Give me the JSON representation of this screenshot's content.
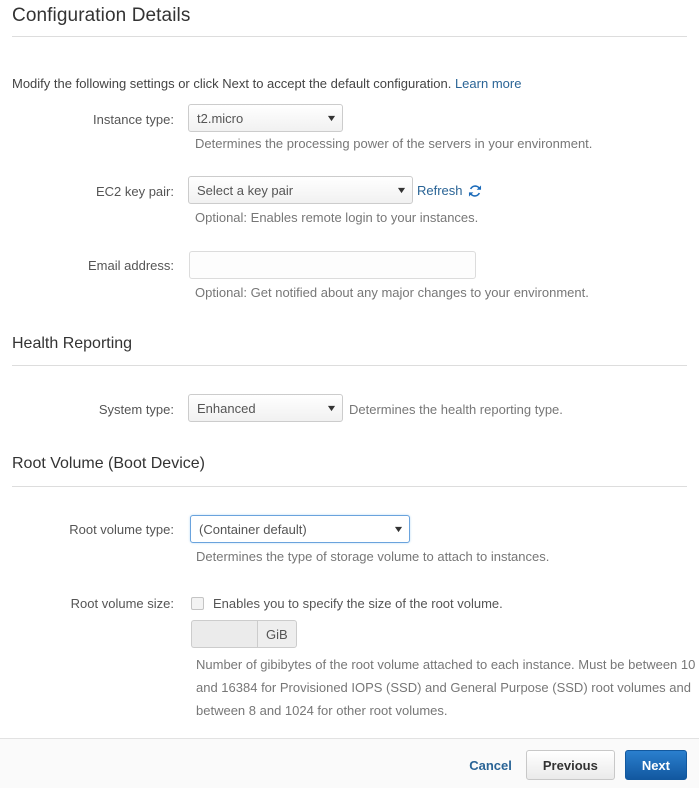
{
  "header": {
    "title": "Configuration Details"
  },
  "intro": {
    "text": "Modify the following settings or click Next to accept the default configuration. ",
    "link_label": "Learn more"
  },
  "fields": {
    "instance_type": {
      "label": "Instance type:",
      "value": "t2.micro",
      "help": "Determines the processing power of the servers in your environment."
    },
    "ec2_key_pair": {
      "label": "EC2 key pair:",
      "value": "Select a key pair",
      "help": "Optional: Enables remote login to your instances.",
      "refresh_label": "Refresh",
      "refresh_icon": "refresh-icon"
    },
    "email_address": {
      "label": "Email address:",
      "value": "",
      "placeholder": "",
      "help": "Optional: Get notified about any major changes to your environment."
    },
    "system_type": {
      "label": "System type:",
      "value": "Enhanced",
      "help": "Determines the health reporting type."
    },
    "root_volume_type": {
      "label": "Root volume type:",
      "value": "(Container default)",
      "help": "Determines the type of storage volume to attach to instances."
    },
    "root_volume_size": {
      "label": "Root volume size:",
      "checkbox_label": "Enables you to specify the size of the root volume.",
      "checked": false,
      "size_value": "",
      "unit_label": "GiB",
      "help": "Number of gibibytes of the root volume attached to each instance. Must be between 10 and 16384 for Provisioned IOPS (SSD) and General Purpose (SSD) root volumes and between 8 and 1024 for other root volumes."
    }
  },
  "sections": {
    "health_reporting": "Health Reporting",
    "root_volume": "Root Volume (Boot Device)"
  },
  "footer": {
    "cancel_label": "Cancel",
    "previous_label": "Previous",
    "next_label": "Next"
  },
  "colors": {
    "link": "#2a6496",
    "primary_button": "#1f6fbf",
    "focus_border": "#6aa3dd",
    "text": "#555555",
    "help_text": "#777777"
  }
}
